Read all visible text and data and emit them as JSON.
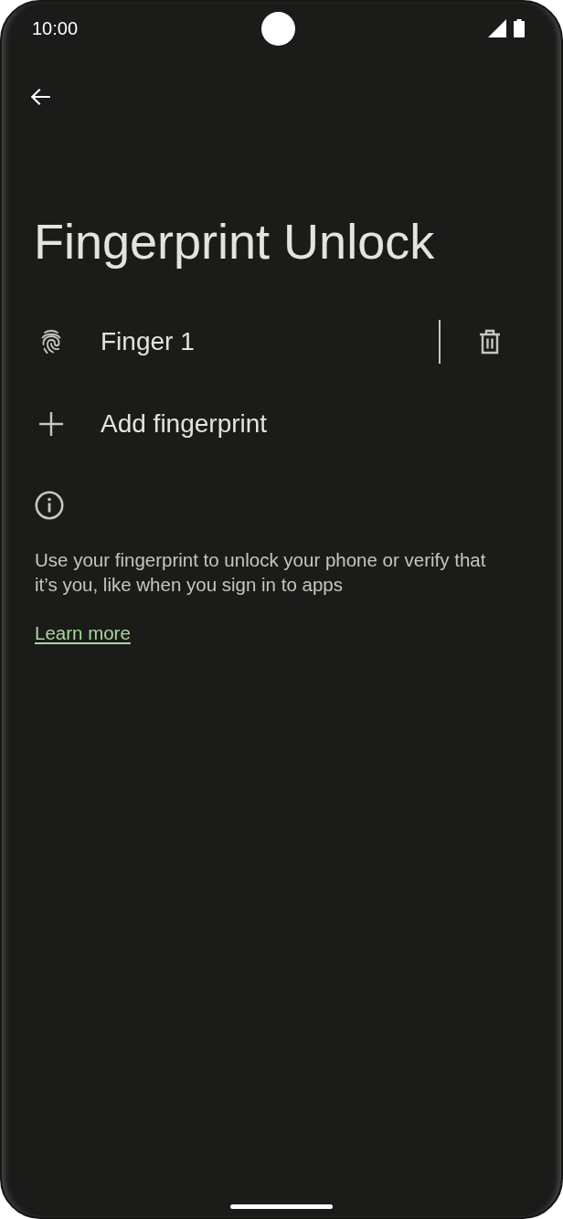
{
  "status_bar": {
    "time": "10:00"
  },
  "title": "Fingerprint Unlock",
  "items": [
    {
      "kind": "fingerprint",
      "label": "Finger 1"
    },
    {
      "kind": "add",
      "label": "Add fingerprint"
    }
  ],
  "info": {
    "text": "Use your fingerprint to unlock your phone or verify that it’s you, like when you sign in to apps",
    "link": "Learn more"
  }
}
